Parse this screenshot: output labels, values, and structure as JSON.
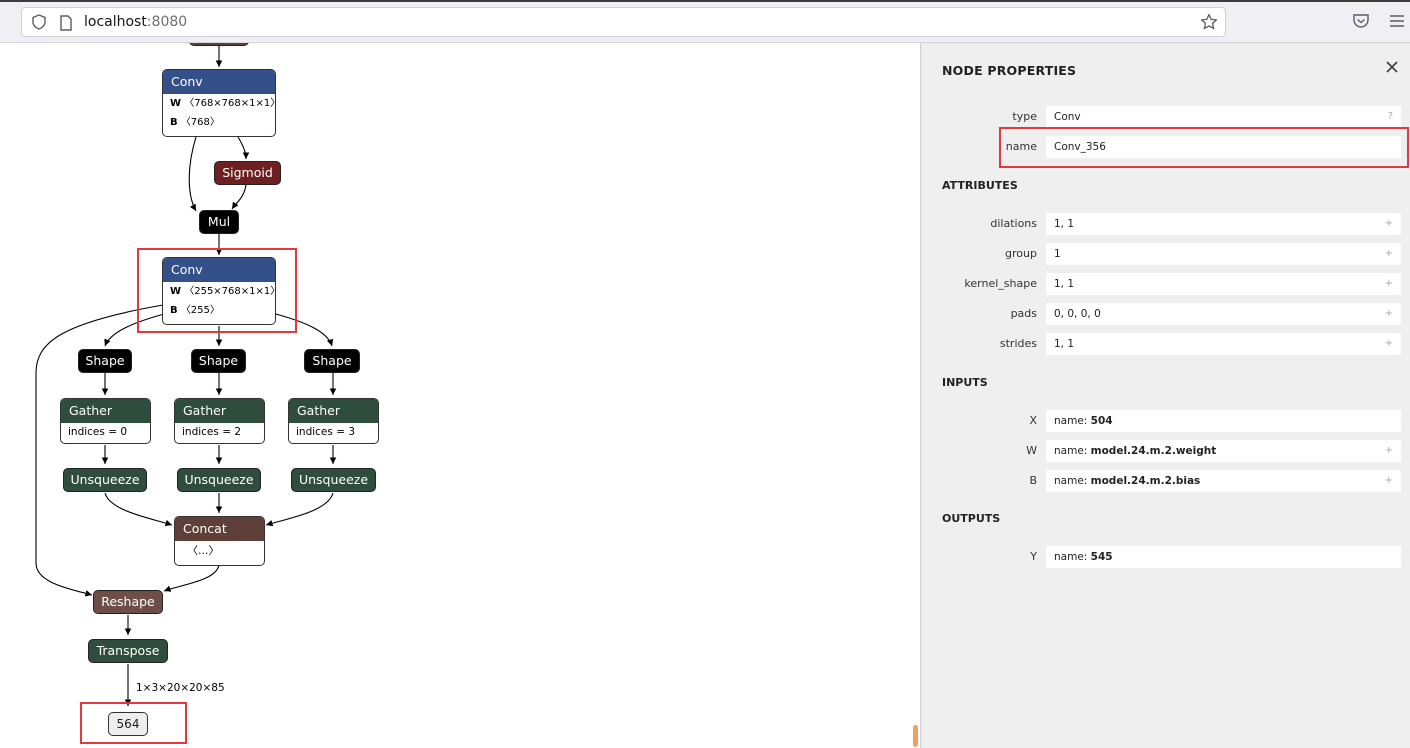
{
  "browser": {
    "url_host": "localhost",
    "url_port": ":8080"
  },
  "graph": {
    "nodes": {
      "conv1": {
        "title": "Conv",
        "w_label": "W",
        "w_shape": "〈768×768×1×1〉",
        "b_label": "B",
        "b_shape": "〈768〉"
      },
      "sigmoid": "Sigmoid",
      "mul": "Mul",
      "conv2": {
        "title": "Conv",
        "w_label": "W",
        "w_shape": "〈255×768×1×1〉",
        "b_label": "B",
        "b_shape": "〈255〉"
      },
      "shape1": "Shape",
      "shape2": "Shape",
      "shape3": "Shape",
      "gather1": {
        "title": "Gather",
        "attr": "indices = 0"
      },
      "gather2": {
        "title": "Gather",
        "attr": "indices = 2"
      },
      "gather3": {
        "title": "Gather",
        "attr": "indices = 3"
      },
      "unsqueeze1": "Unsqueeze",
      "unsqueeze2": "Unsqueeze",
      "unsqueeze3": "Unsqueeze",
      "concat": {
        "title": "Concat",
        "attr": "〈...〉"
      },
      "reshape": "Reshape",
      "transpose": "Transpose",
      "output_edge_label": "1×3×20×20×85",
      "output": "564"
    }
  },
  "panel": {
    "title": "NODE PROPERTIES",
    "close_icon": "close-icon",
    "node": {
      "type_label": "type",
      "type_value": "Conv",
      "type_action": "?",
      "name_label": "name",
      "name_value": "Conv_356"
    },
    "attributes": {
      "heading": "ATTRIBUTES",
      "items": [
        {
          "label": "dilations",
          "value": "1, 1",
          "action": "+"
        },
        {
          "label": "group",
          "value": "1",
          "action": "+"
        },
        {
          "label": "kernel_shape",
          "value": "1, 1",
          "action": "+"
        },
        {
          "label": "pads",
          "value": "0, 0, 0, 0",
          "action": "+"
        },
        {
          "label": "strides",
          "value": "1, 1",
          "action": "+"
        }
      ]
    },
    "inputs": {
      "heading": "INPUTS",
      "items": [
        {
          "label": "X",
          "prefix": "name: ",
          "value": "504",
          "action": ""
        },
        {
          "label": "W",
          "prefix": "name: ",
          "value": "model.24.m.2.weight",
          "action": "+"
        },
        {
          "label": "B",
          "prefix": "name: ",
          "value": "model.24.m.2.bias",
          "action": "+"
        }
      ]
    },
    "outputs": {
      "heading": "OUTPUTS",
      "items": [
        {
          "label": "Y",
          "prefix": "name: ",
          "value": "545"
        }
      ]
    }
  },
  "colors": {
    "conv": "#335188",
    "activation": "#6e2020",
    "layer": "#2f4d3c",
    "concat": "#5e4039",
    "highlight": "#e0393e"
  }
}
